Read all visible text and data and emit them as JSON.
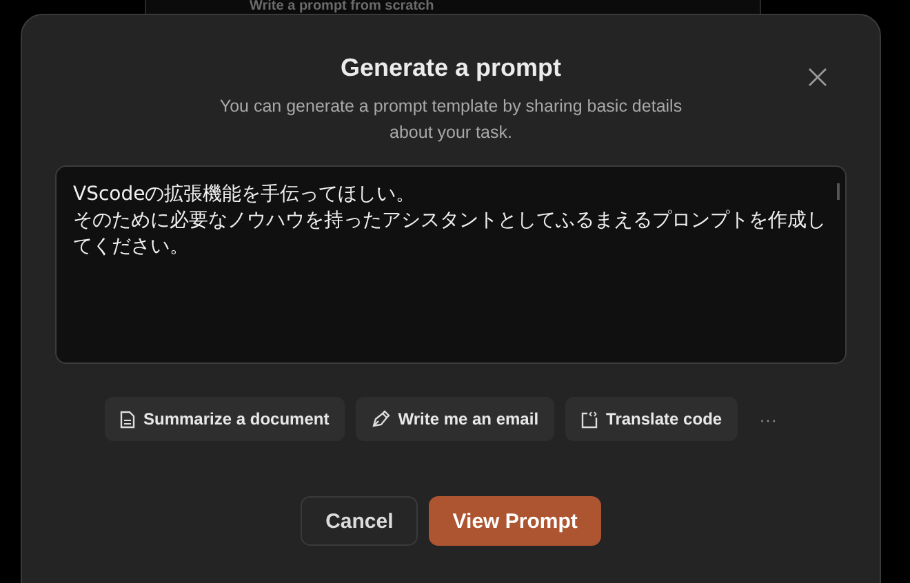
{
  "background": {
    "heading": "Write a prompt from scratch"
  },
  "dialog": {
    "title": "Generate a prompt",
    "subtitle": "You can generate a prompt template by sharing basic details about your task.",
    "prompt_field": {
      "lines": [
        "VScodeの拡張機能を手伝ってほしい。",
        "そのために必要なノウハウを持ったアシスタントとしてふるまえるプロンプトを作成してください。"
      ]
    },
    "suggestions": [
      {
        "kind": "document",
        "label": "Summarize a document"
      },
      {
        "kind": "pen",
        "label": "Write me an email"
      },
      {
        "kind": "code",
        "label": "Translate code"
      }
    ],
    "more": "···",
    "buttons": [
      {
        "kind": "secondary",
        "label": "Cancel"
      },
      {
        "kind": "primary",
        "label": "View Prompt"
      }
    ]
  }
}
